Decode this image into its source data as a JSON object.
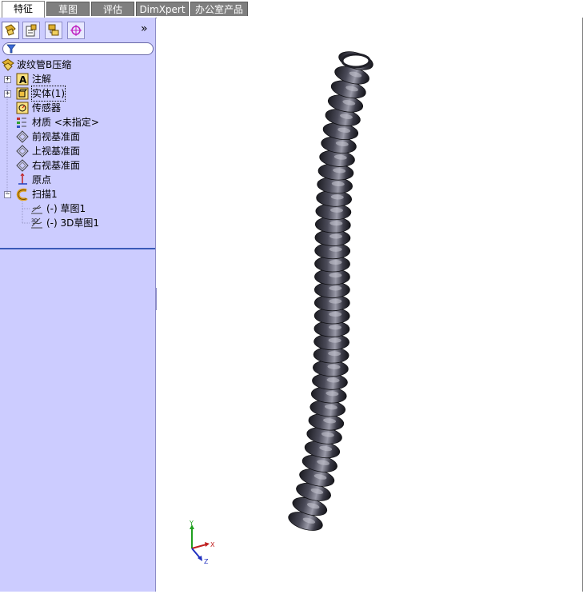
{
  "tabs": [
    {
      "label": "特征",
      "active": true
    },
    {
      "label": "草图",
      "active": false
    },
    {
      "label": "评估",
      "active": false
    },
    {
      "label": "DimXpert",
      "active": false
    },
    {
      "label": "办公室产品",
      "active": false
    }
  ],
  "panel": {
    "collapse_symbol": "»",
    "tree": {
      "root": "波纹管B压缩",
      "items": [
        {
          "label": "注解",
          "icon": "annotation-icon",
          "expandable": "+"
        },
        {
          "label": "实体(1)",
          "icon": "solid-body-icon",
          "expandable": "+"
        },
        {
          "label": "传感器",
          "icon": "sensor-icon"
        },
        {
          "label": "材质 <未指定>",
          "icon": "material-icon"
        },
        {
          "label": "前视基准面",
          "icon": "plane-icon"
        },
        {
          "label": "上视基准面",
          "icon": "plane-icon"
        },
        {
          "label": "右视基准面",
          "icon": "plane-icon"
        },
        {
          "label": "原点",
          "icon": "origin-icon"
        },
        {
          "label": "扫描1",
          "icon": "sweep-icon",
          "expandable": "−"
        },
        {
          "label": "(-) 草图1",
          "icon": "sketch-icon"
        },
        {
          "label": "(-) 3D草图1",
          "icon": "3d-sketch-icon"
        }
      ]
    }
  },
  "triad": {
    "x": "X",
    "y": "Y",
    "z": "Z"
  },
  "colors": {
    "panel_bg": "#ccccff",
    "tab_inactive": "#7f7f7f",
    "model": "#3a3a44",
    "separator": "#3a5ab8"
  }
}
